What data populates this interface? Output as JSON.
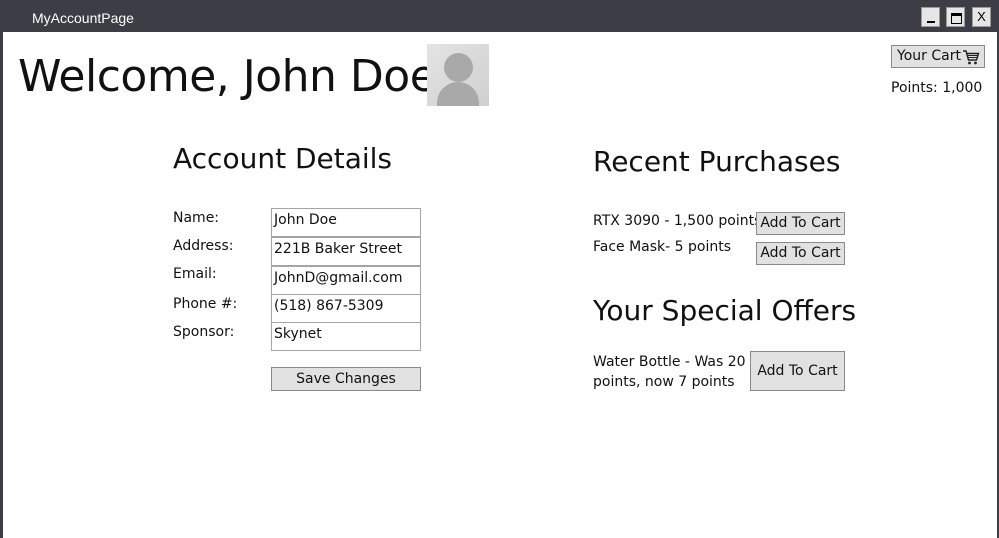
{
  "window": {
    "title": "MyAccountPage",
    "minimize_label": "_",
    "close_label": "X"
  },
  "header": {
    "welcome": "Welcome, John Doe",
    "cart_label": "Your Cart",
    "points": "Points: 1,000"
  },
  "account": {
    "title": "Account Details",
    "fields": [
      {
        "label": "Name:",
        "value": "John Doe"
      },
      {
        "label": "Address:",
        "value": "221B Baker Street"
      },
      {
        "label": "Email:",
        "value": "JohnD@gmail.com"
      },
      {
        "label": "Phone #:",
        "value": "(518) 867-5309"
      },
      {
        "label": "Sponsor:",
        "value": "Skynet"
      }
    ],
    "save_label": "Save Changes"
  },
  "recent": {
    "title": "Recent Purchases",
    "items": [
      {
        "text": "RTX 3090 - 1,500 points",
        "button": "Add To Cart"
      },
      {
        "text": "Face Mask- 5 points",
        "button": "Add To Cart"
      }
    ]
  },
  "offers": {
    "title": "Your Special Offers",
    "items": [
      {
        "text": "Water Bottle - Was 20 points, now 7 points",
        "button": "Add To Cart"
      }
    ]
  },
  "icons": {
    "cart": "shopping-cart-icon",
    "avatar": "user-avatar-icon"
  },
  "colors": {
    "titlebar": "#3d3d45",
    "button_bg": "#e1e1e1"
  }
}
